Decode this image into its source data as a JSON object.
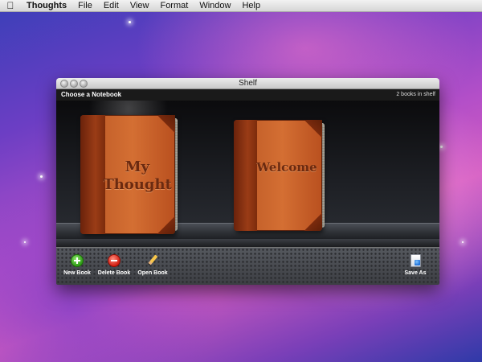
{
  "menubar": {
    "apple_icon": "apple-icon",
    "items": [
      "Thoughts",
      "File",
      "Edit",
      "View",
      "Format",
      "Window",
      "Help"
    ]
  },
  "window": {
    "title": "Shelf",
    "header": {
      "left": "Choose a Notebook",
      "right": "2 books in shelf"
    },
    "books": [
      {
        "title_line1": "My",
        "title_line2": "Thought",
        "selected": true
      },
      {
        "title_line1": "Welcome",
        "title_line2": "",
        "selected": false
      }
    ],
    "toolbar": {
      "new_label": "New Book",
      "delete_label": "Delete Book",
      "open_label": "Open Book",
      "save_label": "Save As"
    }
  },
  "colors": {
    "book_leather": "#c4602a",
    "shelf_dark": "#1d1f24",
    "toolbar": "#4a4d52"
  }
}
